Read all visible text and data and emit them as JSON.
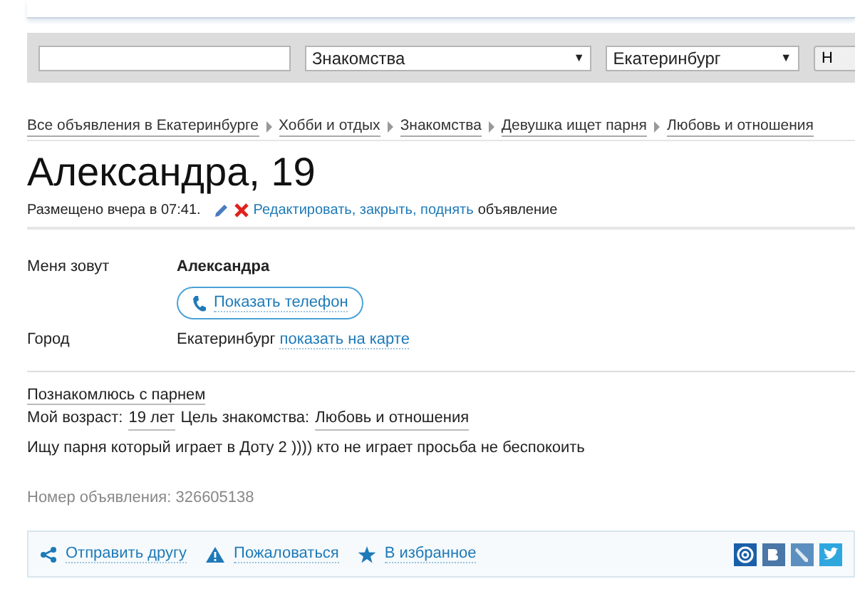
{
  "search_bar": {
    "category_select": {
      "value": "Знакомства",
      "arrow": "▼"
    },
    "city_select": {
      "value": "Екатеринбург",
      "arrow": "▼"
    },
    "button": {
      "label": "Н"
    }
  },
  "breadcrumbs": [
    {
      "label": "Все объявления в Екатеринбурге"
    },
    {
      "label": "Хобби и отдых"
    },
    {
      "label": "Знакомства"
    },
    {
      "label": "Девушка ищет парня"
    },
    {
      "label": "Любовь и отношения"
    }
  ],
  "title": "Александра, 19",
  "meta": {
    "posted": "Размещено вчера в 07:41.",
    "edit_link": "Редактировать, закрыть, поднять",
    "edit_suffix": "объявление"
  },
  "details": [
    {
      "kind": "name",
      "label": "Меня зовут",
      "value": "Александра"
    },
    {
      "kind": "phone",
      "button": "Показать телефон"
    },
    {
      "kind": "city",
      "label": "Город",
      "value": "Екатеринбург",
      "link": "показать на карте"
    }
  ],
  "description": {
    "heading": "Познакомлюсь с парнем",
    "age_label": "Мой возраст:",
    "age_value": "19 лет",
    "goal_label": "Цель знакомства:",
    "goal_value": "Любовь и отношения",
    "text": "Ищу парня который играет в Доту 2 )))) кто не играет просьба не беспокоить"
  },
  "ad_number": "Номер объявления: 326605138",
  "actions": [
    {
      "kind": "share",
      "label": "Отправить другу"
    },
    {
      "kind": "report",
      "label": "Пожаловаться"
    },
    {
      "kind": "favorite",
      "label": "В избранное"
    }
  ],
  "social": [
    {
      "kind": "mail"
    },
    {
      "kind": "vk"
    },
    {
      "kind": "lj"
    },
    {
      "kind": "twitter"
    }
  ]
}
